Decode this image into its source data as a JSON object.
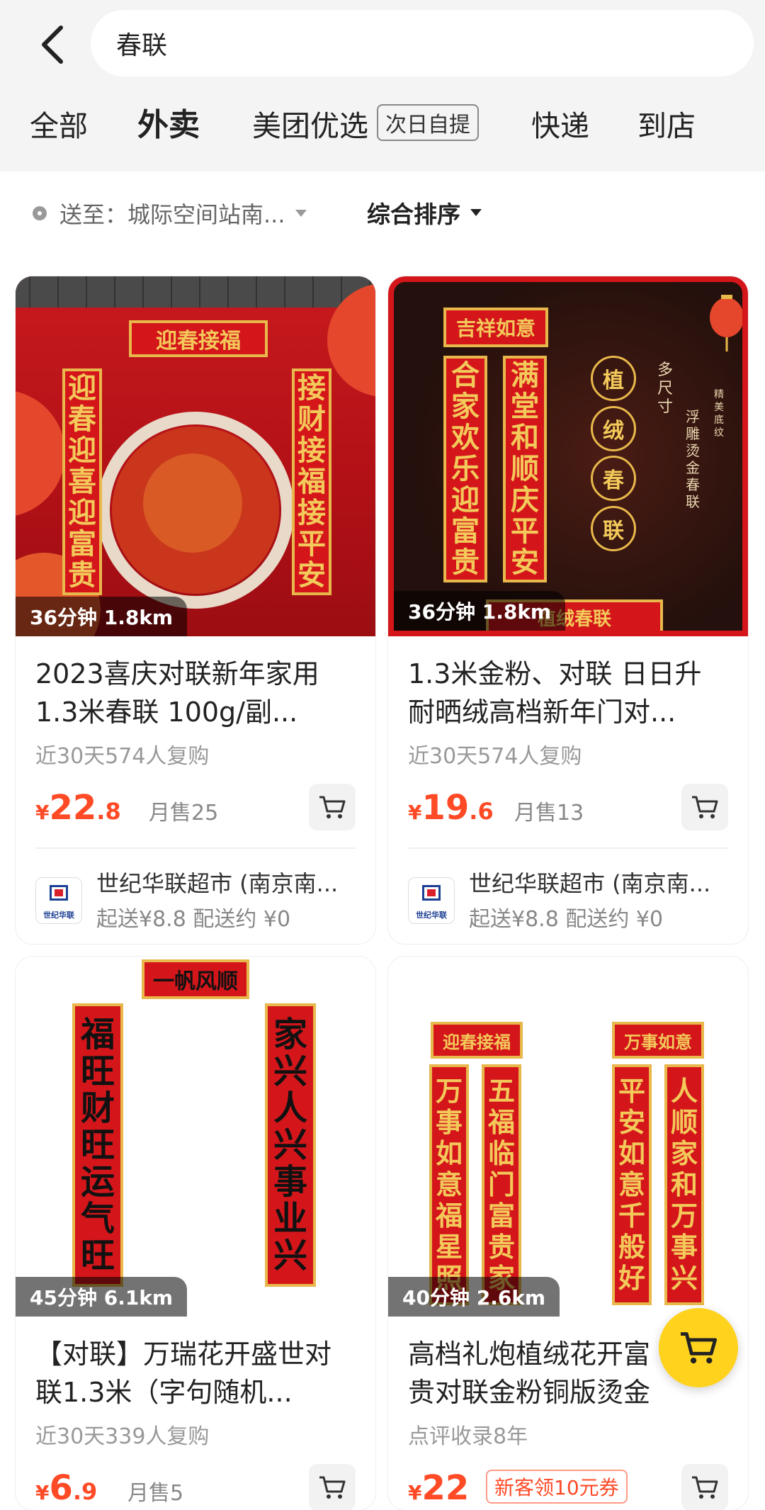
{
  "search": {
    "query": "春联"
  },
  "tabs": [
    {
      "label": "全部"
    },
    {
      "label": "外卖"
    },
    {
      "label": "美团优选",
      "tag": "次日自提"
    },
    {
      "label": "快递"
    },
    {
      "label": "到店"
    }
  ],
  "filter": {
    "location": "送至：城际空间站南...",
    "sort": "综合排序"
  },
  "products": [
    {
      "badge": "36分钟  1.8km",
      "title": "2023喜庆对联新年家用1.3米春联 100g/副...",
      "sub": "近30天574人复购",
      "price_yen": "¥",
      "price_int": "22",
      "price_dec": ".8",
      "sales": "月售25",
      "shop_name": "世纪华联超市 (南京南...",
      "shop_meta": "起送¥8.8   配送约 ¥0",
      "logo_text": "世纪华联",
      "img_text": {
        "top": "迎春接福",
        "left": "迎春迎喜迎富贵",
        "right": "接财接福接平安"
      }
    },
    {
      "badge": "36分钟  1.8km",
      "title": "1.3米金粉、对联 日日升耐晒绒高档新年门对...",
      "sub": "近30天574人复购",
      "price_yen": "¥",
      "price_int": "19",
      "price_dec": ".6",
      "sales": "月售13",
      "shop_name": "世纪华联超市 (南京南...",
      "shop_meta": "起送¥8.8   配送约 ¥0",
      "logo_text": "世纪华联",
      "img_text": {
        "top": "吉祥如意",
        "left": "合家欢乐迎富贵",
        "right": "满堂和顺庆平安",
        "circles": [
          "植",
          "绒",
          "春",
          "联"
        ],
        "side1": "多尺寸",
        "side2": "浮雕烫金春联",
        "side3": "精美底纹",
        "bottom": "植绒春联"
      }
    },
    {
      "badge": "45分钟  6.1km",
      "title": "【对联】万瑞花开盛世对联1.3米（字句随机...",
      "sub": "近30天339人复购",
      "price_yen": "¥",
      "price_int": "6",
      "price_dec": ".9",
      "sales": "月售5",
      "img_text": {
        "top": "一帆风顺",
        "left": "福旺财旺运气旺",
        "right": "家兴人兴事业兴"
      }
    },
    {
      "badge": "40分钟  2.6km",
      "title": "高档礼炮植绒花开富贵对联金粉铜版烫金对...",
      "sub": "点评收录8年",
      "price_yen": "¥",
      "price_int": "22",
      "price_dec": "",
      "coupon": "新客领10元券",
      "img_text": {
        "top1": "迎春接福",
        "top2": "万事如意",
        "c1": "万事如意福星照",
        "c2": "五福临门富贵家",
        "c3": "平安如意千般好",
        "c4": "人顺家和万事兴"
      }
    }
  ],
  "colors": {
    "accent_yellow": "#ffd21e",
    "price_red": "#ff4a26",
    "couplet_red": "#d4161b",
    "gold": "#e8b84b"
  },
  "icons": [
    "back-arrow-icon",
    "location-pin-icon",
    "cart-icon"
  ]
}
